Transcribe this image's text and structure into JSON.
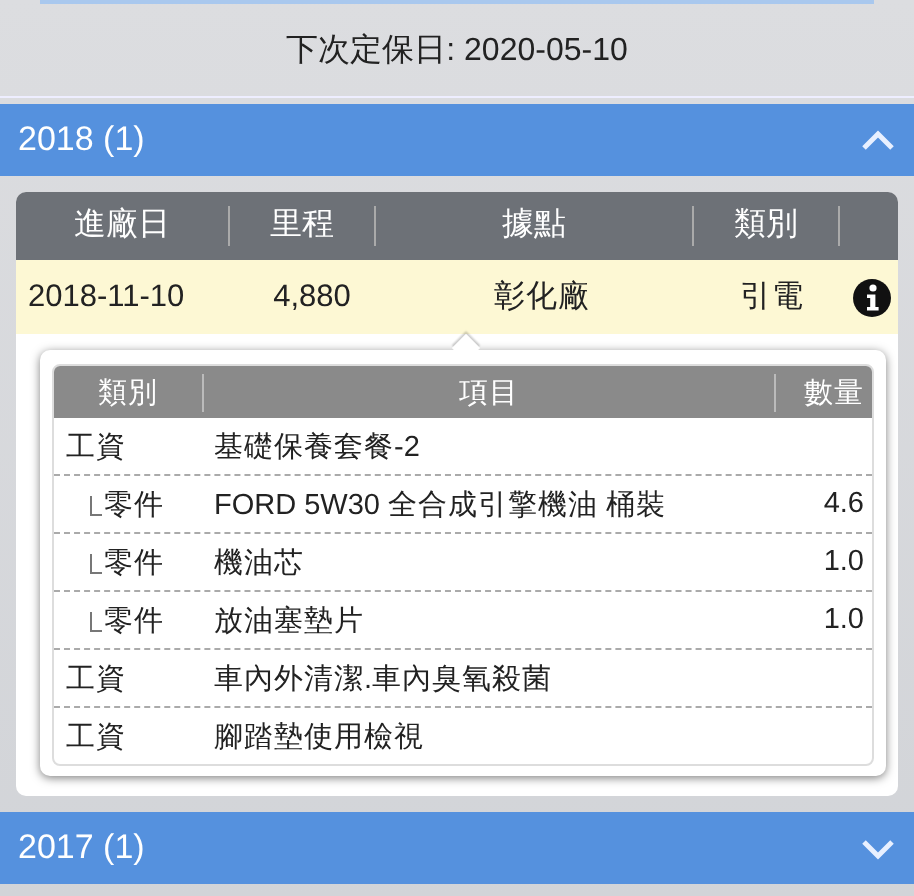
{
  "next_service": "下次定保日: 2020-05-10",
  "sections": [
    {
      "title": "2018 (1)",
      "expanded": true,
      "columns": [
        "進廠日",
        "里程",
        "據點",
        "類別"
      ],
      "records": [
        {
          "date": "2018-11-10",
          "mileage": "4,880",
          "location": "彰化廠",
          "type": "引電",
          "details_open": true
        }
      ],
      "detail_columns": [
        "類別",
        "項目",
        "數量"
      ],
      "detail_items": [
        {
          "category": "工資",
          "item": "基礎保養套餐-2",
          "children": [
            {
              "category": "零件",
              "item": "FORD 5W30 全合成引擎機油 桶裝",
              "quantity": "4.6"
            },
            {
              "category": "零件",
              "item": "機油芯",
              "quantity": "1.0"
            },
            {
              "category": "零件",
              "item": "放油塞墊片",
              "quantity": "1.0"
            }
          ]
        },
        {
          "category": "工資",
          "item": "車內外清潔.車內臭氧殺菌"
        },
        {
          "category": "工資",
          "item": "腳踏墊使用檢視"
        }
      ]
    },
    {
      "title": "2017 (1)",
      "expanded": false
    }
  ]
}
